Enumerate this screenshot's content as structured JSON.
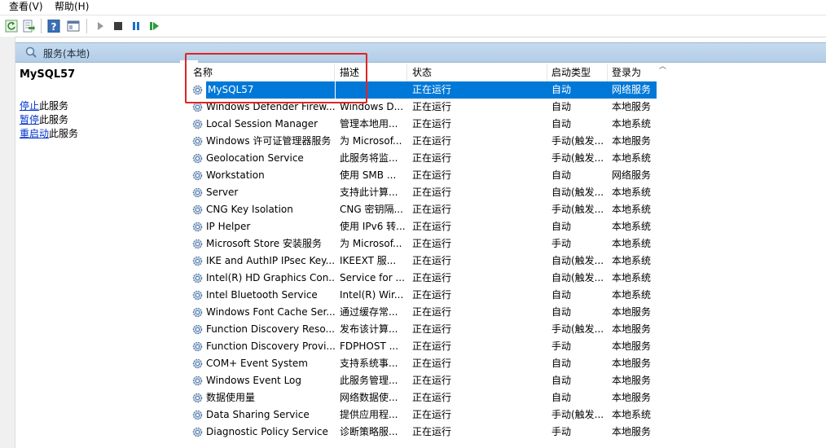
{
  "menu": {
    "view": "查看(V)",
    "help": "帮助(H)"
  },
  "pane": {
    "title": "服务(本地)"
  },
  "details": {
    "service_name": "MySQL57",
    "actions": [
      {
        "link": "停止",
        "suffix": "此服务"
      },
      {
        "link": "暂停",
        "suffix": "此服务"
      },
      {
        "link": "重启动",
        "suffix": "此服务"
      }
    ]
  },
  "columns": {
    "name": "名称",
    "desc": "描述",
    "status": "状态",
    "startup": "启动类型",
    "logon": "登录为"
  },
  "rows": [
    {
      "name": "MySQL57",
      "desc": "",
      "status": "正在运行",
      "startup": "自动",
      "logon": "网络服务"
    },
    {
      "name": "Windows Defender Firew...",
      "desc": "Windows D...",
      "status": "正在运行",
      "startup": "自动",
      "logon": "本地服务"
    },
    {
      "name": "Local Session Manager",
      "desc": "管理本地用...",
      "status": "正在运行",
      "startup": "自动",
      "logon": "本地系统"
    },
    {
      "name": "Windows 许可证管理器服务",
      "desc": "为 Microsof...",
      "status": "正在运行",
      "startup": "手动(触发...",
      "logon": "本地服务"
    },
    {
      "name": "Geolocation Service",
      "desc": "此服务将监...",
      "status": "正在运行",
      "startup": "手动(触发...",
      "logon": "本地系统"
    },
    {
      "name": "Workstation",
      "desc": "使用 SMB ...",
      "status": "正在运行",
      "startup": "自动",
      "logon": "网络服务"
    },
    {
      "name": "Server",
      "desc": "支持此计算...",
      "status": "正在运行",
      "startup": "自动(触发...",
      "logon": "本地系统"
    },
    {
      "name": "CNG Key Isolation",
      "desc": "CNG 密钥隔...",
      "status": "正在运行",
      "startup": "手动(触发...",
      "logon": "本地系统"
    },
    {
      "name": "IP Helper",
      "desc": "使用 IPv6 转...",
      "status": "正在运行",
      "startup": "自动",
      "logon": "本地系统"
    },
    {
      "name": "Microsoft Store 安装服务",
      "desc": "为 Microsof...",
      "status": "正在运行",
      "startup": "手动",
      "logon": "本地系统"
    },
    {
      "name": "IKE and AuthIP IPsec Key...",
      "desc": "IKEEXT 服...",
      "status": "正在运行",
      "startup": "自动(触发...",
      "logon": "本地系统"
    },
    {
      "name": "Intel(R) HD Graphics Con...",
      "desc": "Service for ...",
      "status": "正在运行",
      "startup": "自动(触发...",
      "logon": "本地系统"
    },
    {
      "name": "Intel Bluetooth Service",
      "desc": "Intel(R) Wir...",
      "status": "正在运行",
      "startup": "自动",
      "logon": "本地系统"
    },
    {
      "name": "Windows Font Cache Ser...",
      "desc": "通过缓存常...",
      "status": "正在运行",
      "startup": "自动",
      "logon": "本地服务"
    },
    {
      "name": "Function Discovery Reso...",
      "desc": "发布该计算...",
      "status": "正在运行",
      "startup": "手动(触发...",
      "logon": "本地服务"
    },
    {
      "name": "Function Discovery Provi...",
      "desc": "FDPHOST ...",
      "status": "正在运行",
      "startup": "手动",
      "logon": "本地服务"
    },
    {
      "name": "COM+ Event System",
      "desc": "支持系统事...",
      "status": "正在运行",
      "startup": "自动",
      "logon": "本地服务"
    },
    {
      "name": "Windows Event Log",
      "desc": "此服务管理...",
      "status": "正在运行",
      "startup": "自动",
      "logon": "本地服务"
    },
    {
      "name": "数据使用量",
      "desc": "网络数据使...",
      "status": "正在运行",
      "startup": "自动",
      "logon": "本地服务"
    },
    {
      "name": "Data Sharing Service",
      "desc": "提供应用程...",
      "status": "正在运行",
      "startup": "手动(触发...",
      "logon": "本地系统"
    },
    {
      "name": "Diagnostic Policy Service",
      "desc": "诊断策略服...",
      "status": "正在运行",
      "startup": "手动",
      "logon": "本地服务"
    }
  ]
}
